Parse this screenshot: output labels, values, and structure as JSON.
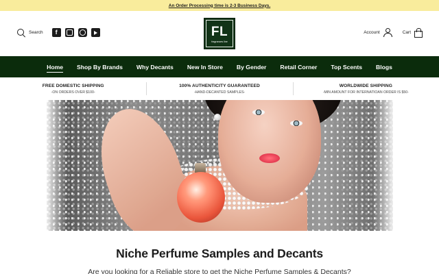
{
  "announcement": {
    "text": "An Order Processing time is 2-3 Business Days."
  },
  "header": {
    "search_label": "Search",
    "social_icons": [
      "facebook-icon",
      "instagram-icon",
      "pinterest-icon",
      "youtube-icon"
    ],
    "logo": {
      "mark": "FL",
      "subtitle": "fragrances line"
    },
    "account_label": "Account",
    "cart_label": "Cart"
  },
  "nav": {
    "items": [
      {
        "label": "Home",
        "active": true
      },
      {
        "label": "Shop By Brands"
      },
      {
        "label": "Why Decants"
      },
      {
        "label": "New In Store"
      },
      {
        "label": "By Gender"
      },
      {
        "label": "Retail Corner"
      },
      {
        "label": "Top Scents"
      },
      {
        "label": "Blogs"
      }
    ]
  },
  "usp": [
    {
      "title": "FREE DOMESTIC SHIPPING",
      "subtitle": "-ON ORDERS OVER $100-"
    },
    {
      "title": "100% AUTHENTICITY GUARANTEED",
      "subtitle": "-HAND-DECANTED SAMPLES-"
    },
    {
      "title": "WORLDWIDE SHIPPING",
      "subtitle": "-MIN AMOUNT FOR INTERNATIOAN ORDER IS $50-"
    }
  ],
  "main": {
    "headline": "Niche Perfume Samples and Decants",
    "intro": "Are you looking for a Reliable store to get the Niche Perfume Samples & Decants?"
  },
  "colors": {
    "announcement_bg": "#f9ec9c",
    "nav_bg": "#0b2c0c",
    "logo_bg": "#123317"
  }
}
